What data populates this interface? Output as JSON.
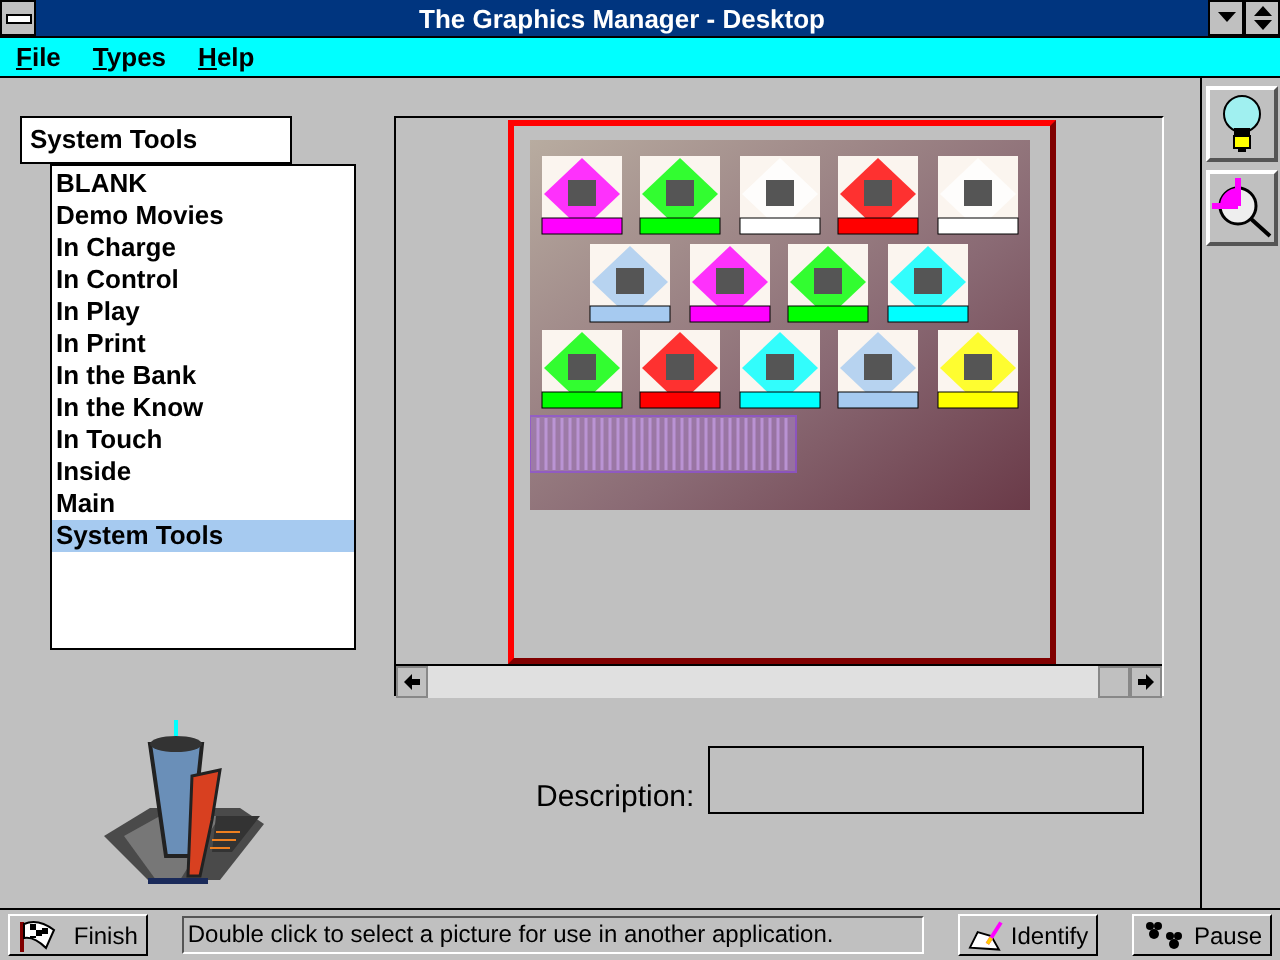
{
  "window": {
    "title": "The Graphics Manager - Desktop"
  },
  "menu": [
    {
      "label": "File"
    },
    {
      "label": "Types"
    },
    {
      "label": "Help"
    }
  ],
  "category_field": {
    "value": "System Tools"
  },
  "categories": [
    {
      "label": "BLANK",
      "selected": false
    },
    {
      "label": "Demo Movies",
      "selected": false
    },
    {
      "label": "In Charge",
      "selected": false
    },
    {
      "label": "In Control",
      "selected": false
    },
    {
      "label": "In Play",
      "selected": false
    },
    {
      "label": "In Print",
      "selected": false
    },
    {
      "label": "In the Bank",
      "selected": false
    },
    {
      "label": "In the Know",
      "selected": false
    },
    {
      "label": "In Touch",
      "selected": false
    },
    {
      "label": "Inside",
      "selected": false
    },
    {
      "label": "Main",
      "selected": false
    },
    {
      "label": "System Tools",
      "selected": true
    }
  ],
  "description": {
    "label": "Description:"
  },
  "status_bar": {
    "finish": "Finish",
    "message": "Double click to select a picture for use in another application.",
    "identify": "Identify",
    "pause": "Pause"
  }
}
